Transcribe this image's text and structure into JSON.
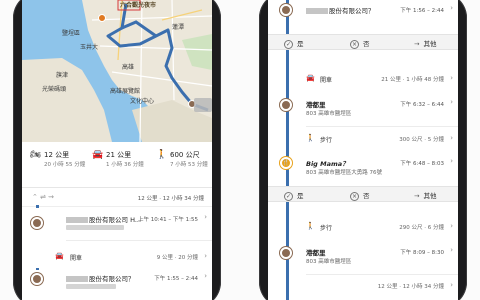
{
  "left": {
    "map": {
      "places": [
        "六合觀光夜市",
        "鹽埕區",
        "蓮潭",
        "高雄",
        "高雄展覽館",
        "旗津",
        "玉井大",
        "光榮碼頭",
        "文化中心"
      ]
    },
    "modes": [
      {
        "icon": "motorcycle-icon",
        "glyph": "🏍",
        "value": "12 公里",
        "sub": "20 小時 55 分鐘"
      },
      {
        "icon": "car-icon",
        "glyph": "🚘",
        "value": "21 公里",
        "sub": "1 小時 36 分鐘"
      },
      {
        "icon": "walk-icon",
        "glyph": "🚶",
        "value": "600 公尺",
        "sub": "7 小時 53 分鐘"
      }
    ],
    "trip_bar": {
      "icons": "⌃  ⇌  ⇝",
      "text": "12 公里 · 12 小時 34 分鐘"
    },
    "stops": [
      {
        "title": "股份有限公司 H...",
        "time": "上午 10:41 – 下午 1:55"
      },
      {
        "title": "股份有限公司？",
        "time": "下午 1:55 – 2:44"
      }
    ],
    "drive": {
      "label": "開車",
      "meta": "9 公里 · 20 分鐘"
    }
  },
  "right": {
    "stop1": {
      "title": "股份有限公司？",
      "time": "下午 1:56 – 2:44"
    },
    "confirm1": {
      "yes": "是",
      "no": "否",
      "other": "其他"
    },
    "drive": {
      "label": "開車",
      "meta": "21 公里 · 1 小時 48 分鐘"
    },
    "harbor1": {
      "title": "港都里",
      "address": "803 高雄市鹽埕區",
      "time": "下午 6:32 – 6:44"
    },
    "walk1": {
      "label": "步行",
      "meta": "300 公尺 · 5 分鐘"
    },
    "food": {
      "title": "Big Mama？",
      "address": "803 高雄市鹽埕區大勇路 76號",
      "time": "下午 6:48 – 8:03"
    },
    "confirm2": {
      "yes": "是",
      "no": "否",
      "other": "其他"
    },
    "walk2": {
      "label": "步行",
      "meta": "290 公尺 · 6 分鐘"
    },
    "harbor2": {
      "title": "港都里",
      "address": "803 高雄市鹽埕區",
      "time": "下午 8:09 – 8:30"
    },
    "total": {
      "meta": "12 公里 · 12 小時 34 分鐘"
    }
  },
  "colors": {
    "route": "#3b6fae",
    "pin": "#8a6a53",
    "food_pin": "#e8a21c",
    "water": "#8ec4ea",
    "land": "#e8e4d8"
  }
}
